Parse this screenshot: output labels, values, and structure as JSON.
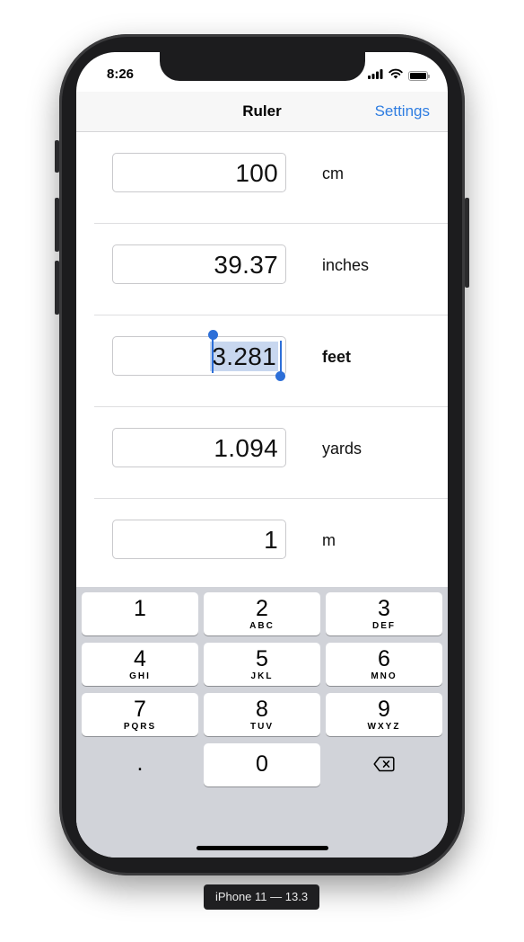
{
  "status_bar": {
    "time": "8:26"
  },
  "navbar": {
    "title": "Ruler",
    "settings_label": "Settings"
  },
  "rows": [
    {
      "value": "100",
      "unit": "cm"
    },
    {
      "value": "39.37",
      "unit": "inches"
    },
    {
      "value": "3.281",
      "unit": "feet",
      "selected": true
    },
    {
      "value": "1.094",
      "unit": "yards"
    },
    {
      "value": "1",
      "unit": "m"
    }
  ],
  "keypad": {
    "keys": [
      {
        "digit": "1",
        "letters": ""
      },
      {
        "digit": "2",
        "letters": "ABC"
      },
      {
        "digit": "3",
        "letters": "DEF"
      },
      {
        "digit": "4",
        "letters": "GHI"
      },
      {
        "digit": "5",
        "letters": "JKL"
      },
      {
        "digit": "6",
        "letters": "MNO"
      },
      {
        "digit": "7",
        "letters": "PQRS"
      },
      {
        "digit": "8",
        "letters": "TUV"
      },
      {
        "digit": "9",
        "letters": "WXYZ"
      }
    ],
    "decimal": ".",
    "zero": "0",
    "delete_icon": "backspace-icon"
  },
  "simulator": {
    "label": "iPhone 11 — 13.3"
  },
  "colors": {
    "accent": "#2f7de1",
    "selection": "#c8d7ef",
    "keypad_bg": "#d1d3d9"
  }
}
